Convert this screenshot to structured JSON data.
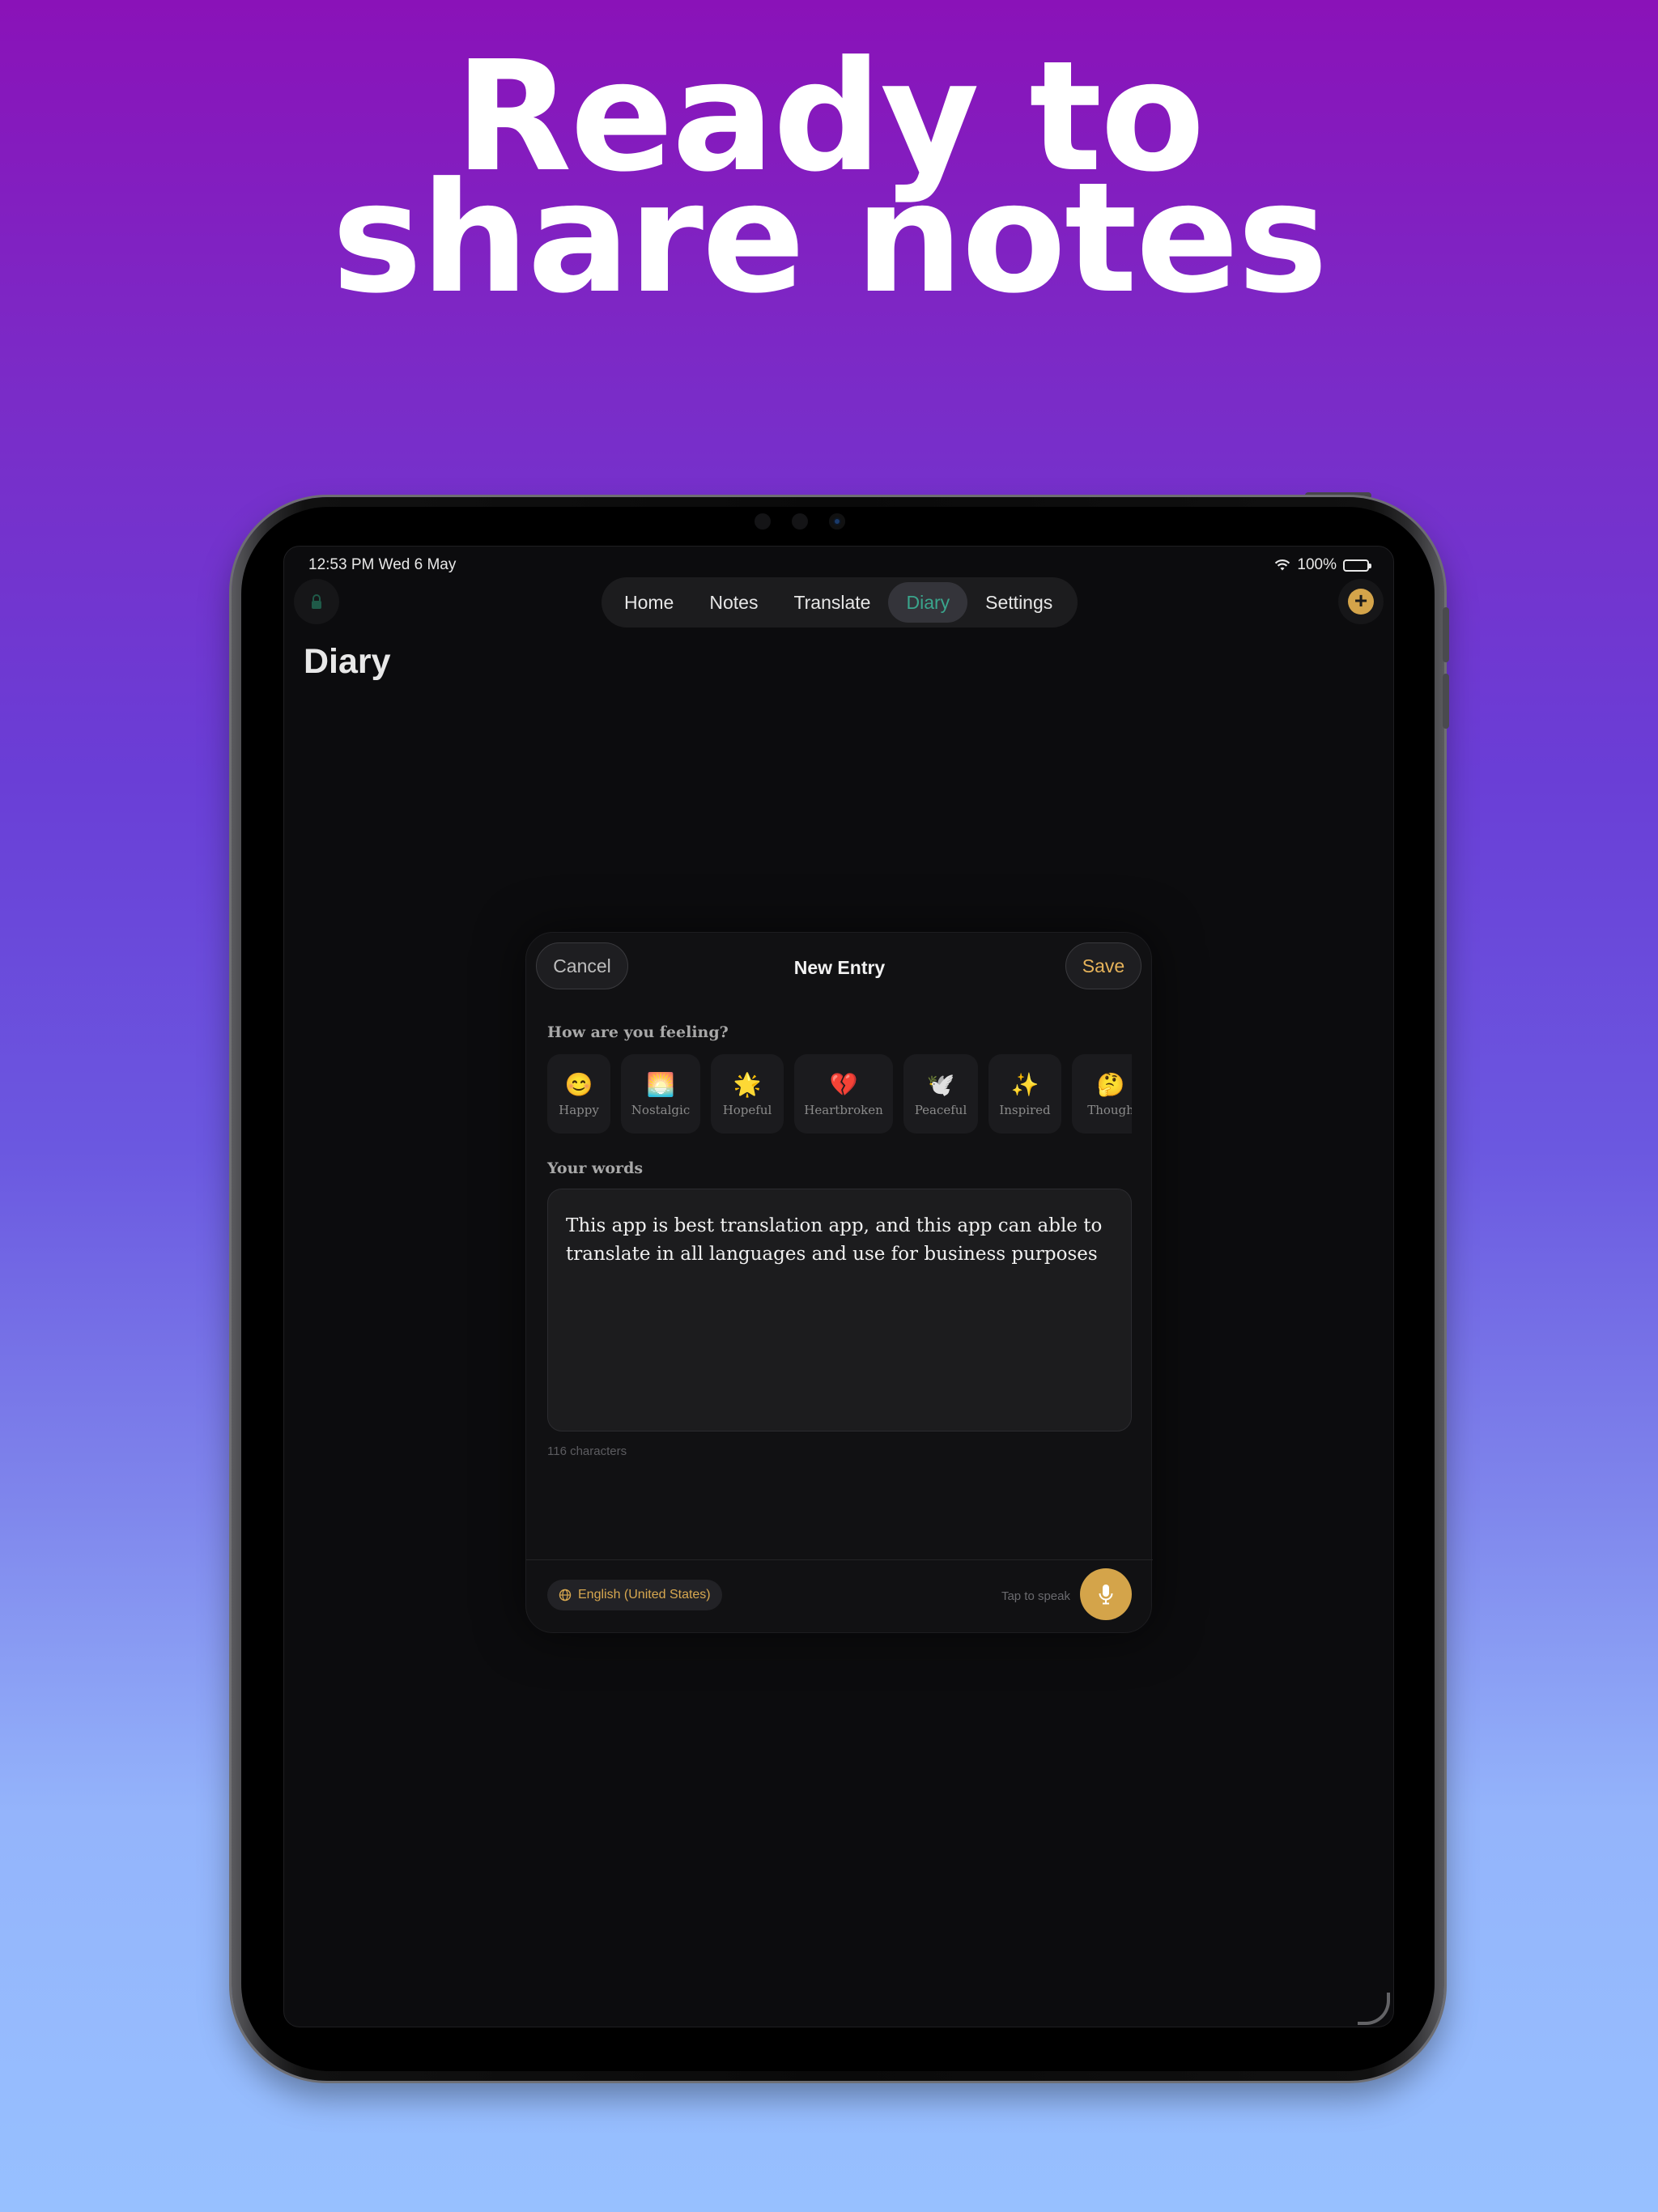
{
  "headline": {
    "line1": "Ready to",
    "line2": "share notes"
  },
  "status_bar": {
    "time_date": "12:53 PM   Wed 6 May",
    "battery": "100%"
  },
  "nav": {
    "items": [
      "Home",
      "Notes",
      "Translate",
      "Diary",
      "Settings"
    ],
    "active": "Diary"
  },
  "page": {
    "title": "Diary"
  },
  "modal": {
    "cancel_label": "Cancel",
    "title": "New Entry",
    "save_label": "Save",
    "feeling_label": "How are you feeling?",
    "moods": [
      {
        "emoji": "😊",
        "label": "Happy"
      },
      {
        "emoji": "🌅",
        "label": "Nostalgic"
      },
      {
        "emoji": "🌟",
        "label": "Hopeful"
      },
      {
        "emoji": "💔",
        "label": "Heartbroken"
      },
      {
        "emoji": "🕊️",
        "label": "Peaceful"
      },
      {
        "emoji": "✨",
        "label": "Inspired"
      },
      {
        "emoji": "🤔",
        "label": "Though"
      }
    ],
    "words_label": "Your words",
    "entry_text": "This app is best translation app, and this app can able to translate in all languages and use for business purposes",
    "char_count": "116 characters",
    "language": "English (United States)",
    "tap_to_speak": "Tap to speak"
  },
  "colors": {
    "accent_gold": "#d4a44a",
    "accent_teal": "#3aa58c"
  }
}
